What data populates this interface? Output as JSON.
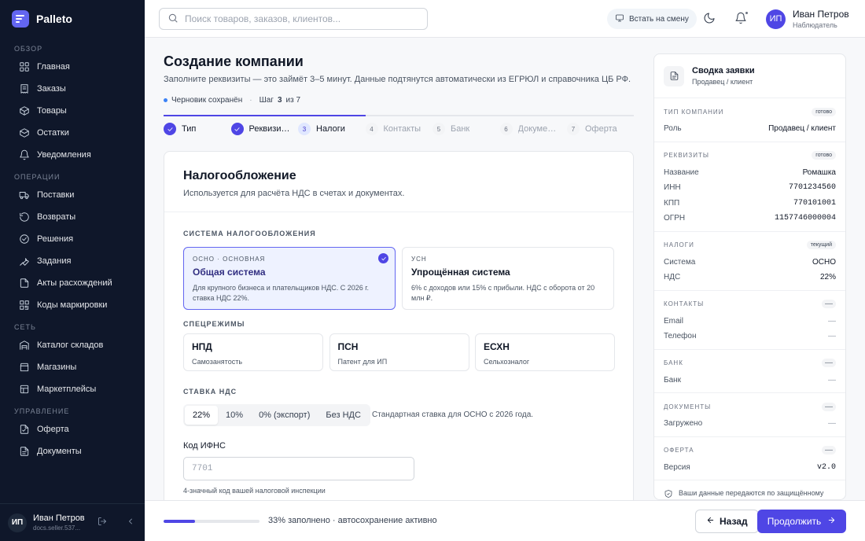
{
  "brand": {
    "name": "Palleto"
  },
  "sidebar": {
    "sections": [
      {
        "label": "Обзор",
        "items": [
          {
            "label": "Главная",
            "icon": "home-icon"
          },
          {
            "label": "Заказы",
            "icon": "orders-icon"
          },
          {
            "label": "Товары",
            "icon": "box-icon"
          },
          {
            "label": "Остатки",
            "icon": "stock-icon"
          },
          {
            "label": "Уведомления",
            "icon": "bell-icon"
          }
        ]
      },
      {
        "label": "Операции",
        "items": [
          {
            "label": "Поставки",
            "icon": "truck-icon"
          },
          {
            "label": "Возвраты",
            "icon": "return-icon"
          },
          {
            "label": "Решения",
            "icon": "decision-icon"
          },
          {
            "label": "Задания",
            "icon": "wrench-icon"
          },
          {
            "label": "Акты расхождений",
            "icon": "document-icon"
          },
          {
            "label": "Коды маркировки",
            "icon": "qr-icon"
          }
        ]
      },
      {
        "label": "Сеть",
        "items": [
          {
            "label": "Каталог складов",
            "icon": "warehouse-icon"
          },
          {
            "label": "Магазины",
            "icon": "store-icon"
          },
          {
            "label": "Маркетплейсы",
            "icon": "marketplace-icon"
          }
        ]
      },
      {
        "label": "Управление",
        "items": [
          {
            "label": "Оферта",
            "icon": "offer-icon"
          },
          {
            "label": "Документы",
            "icon": "documents-icon"
          }
        ]
      }
    ],
    "user": {
      "initials": "ИП",
      "name": "Иван Петров",
      "email": "docs.seller.537..."
    }
  },
  "topbar": {
    "search_placeholder": "Поиск товаров, заказов, клиентов...",
    "shift_label": "Встать на смену",
    "user": {
      "initials": "ИП",
      "name": "Иван Петров",
      "role": "Наблюдатель"
    }
  },
  "page": {
    "title": "Создание компании",
    "subtitle": "Заполните реквизиты — это займёт 3–5 минут. Данные подтянутся автоматически из ЕГРЮЛ и справочника ЦБ РФ.",
    "draft_status": "Черновик сохранён",
    "step_prefix": "Шаг",
    "step_current": "3",
    "step_of": "из 7",
    "step_progress": 0.43,
    "steps": [
      {
        "label": "Тип",
        "state": "done",
        "num": ""
      },
      {
        "label": "Реквизиты",
        "state": "done",
        "num": ""
      },
      {
        "label": "Налоги",
        "state": "current",
        "num": "3"
      },
      {
        "label": "Контакты",
        "state": "todo",
        "num": "4"
      },
      {
        "label": "Банк",
        "state": "todo",
        "num": "5"
      },
      {
        "label": "Документы",
        "state": "todo",
        "num": "6"
      },
      {
        "label": "Оферта",
        "state": "todo",
        "num": "7"
      }
    ]
  },
  "tax": {
    "title": "Налогообложение",
    "subtitle": "Используется для расчёта НДС в счетах и документах.",
    "system_label": "Система налогообложения",
    "systems": [
      {
        "kicker": "ОСНО · основная",
        "title": "Общая система",
        "desc": "Для крупного бизнеса и плательщиков НДС. С 2026 г. ставка НДС 22%.",
        "selected": true
      },
      {
        "kicker": "УСН",
        "title": "Упрощённая система",
        "desc": "6% с доходов или 15% с прибыли. НДС с оборота от 20 млн ₽.",
        "selected": false
      }
    ],
    "special_label": "Спецрежимы",
    "specials": [
      {
        "title": "НПД",
        "desc": "Самозанятость"
      },
      {
        "title": "ПСН",
        "desc": "Патент для ИП"
      },
      {
        "title": "ЕСХН",
        "desc": "Сельхозналог"
      }
    ],
    "vat_label": "Ставка НДС",
    "vat_options": [
      "22%",
      "10%",
      "0% (экспорт)",
      "Без НДС"
    ],
    "vat_selected": "22%",
    "vat_hint": "Стандартная ставка для ОСНО с 2026 года.",
    "ifns_label": "Код ИФНС",
    "ifns_placeholder": "7701",
    "ifns_hint": "4-значный код вашей налоговой инспекции"
  },
  "summary": {
    "title": "Сводка заявки",
    "subtitle": "Продавец / клиент",
    "sections": [
      {
        "label": "Тип компании",
        "status": "готово",
        "rows": [
          {
            "k": "Роль",
            "v": "Продавец / клиент",
            "mono": false
          }
        ]
      },
      {
        "label": "Реквизиты",
        "status": "готово",
        "rows": [
          {
            "k": "Название",
            "v": "Ромашка",
            "mono": false
          },
          {
            "k": "ИНН",
            "v": "7701234560",
            "mono": true
          },
          {
            "k": "КПП",
            "v": "770101001",
            "mono": true
          },
          {
            "k": "ОГРН",
            "v": "1157746000004",
            "mono": true
          }
        ]
      },
      {
        "label": "Налоги",
        "status": "текущий",
        "rows": [
          {
            "k": "Система",
            "v": "ОСНО",
            "mono": false
          },
          {
            "k": "НДС",
            "v": "22%",
            "mono": false
          }
        ]
      },
      {
        "label": "Контакты",
        "status": "—",
        "rows": [
          {
            "k": "Email",
            "v": "—",
            "mono": false
          },
          {
            "k": "Телефон",
            "v": "—",
            "mono": false
          }
        ]
      },
      {
        "label": "Банк",
        "status": "—",
        "rows": [
          {
            "k": "Банк",
            "v": "—",
            "mono": false
          }
        ]
      },
      {
        "label": "Документы",
        "status": "—",
        "rows": [
          {
            "k": "Загружено",
            "v": "—",
            "mono": false
          }
        ]
      },
      {
        "label": "Оферта",
        "status": "—",
        "rows": [
          {
            "k": "Версия",
            "v": "v2.0",
            "mono": true
          }
        ]
      }
    ],
    "note": "Ваши данные передаются по защищённому соединению и проверяются в ЕГРЮЛ. Мы не"
  },
  "footer": {
    "progress": 0.33,
    "progress_text": "33% заполнено · автосохранение активно",
    "back_label": "Назад",
    "next_label": "Продолжить"
  },
  "colors": {
    "accent": "#4f46e5",
    "sidebar_bg": "#0f172a",
    "selected_bg": "#eef2ff"
  }
}
